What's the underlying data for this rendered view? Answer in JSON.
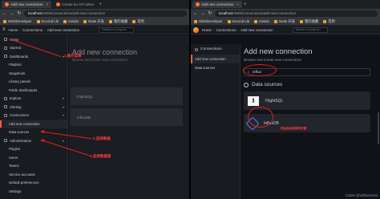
{
  "left": {
    "tabs": [
      {
        "label": "Add new connection",
        "active": true
      },
      {
        "label": "Create an API token",
        "active": false
      }
    ],
    "url_host": "localhost",
    "url_path": ":3000/connections/add-new-connection",
    "bookmarks": [
      "Web/Developer",
      "Second Lib",
      "mosdo",
      "Node 开发",
      "我的收藏",
      "常用"
    ],
    "breadcrumb": {
      "home": "Home",
      "section": "Connections",
      "page": "Add new connection"
    },
    "search_placeholder": "Search or jump to...",
    "menu": [
      {
        "label": "Home",
        "sub": false
      },
      {
        "label": "Starred",
        "sub": false
      },
      {
        "label": "Dashboards",
        "sub": false
      },
      {
        "label": "Playlists",
        "sub": true
      },
      {
        "label": "Snapshots",
        "sub": true
      },
      {
        "label": "Library panels",
        "sub": true
      },
      {
        "label": "Public dashboards",
        "sub": true
      },
      {
        "label": "Explore",
        "sub": false
      },
      {
        "label": "Alerting",
        "sub": false
      },
      {
        "label": "Connections",
        "sub": false
      },
      {
        "label": "Add new connection",
        "sub": true,
        "active": true
      },
      {
        "label": "Data sources",
        "sub": true
      },
      {
        "label": "Administration",
        "sub": false
      },
      {
        "label": "Plugins",
        "sub": true
      },
      {
        "label": "Users",
        "sub": true
      },
      {
        "label": "Teams",
        "sub": true
      },
      {
        "label": "Service accounts",
        "sub": true
      },
      {
        "label": "Default preferences",
        "sub": true
      },
      {
        "label": "Settings",
        "sub": true
      }
    ],
    "content_title": "Add new connection",
    "content_sub": "Browse and create new connections",
    "cards": [
      "FlightSQL",
      "InfluxDB"
    ],
    "annotations": [
      "1.展开菜单",
      "2.选择数据",
      "3.选择数据源"
    ]
  },
  "right": {
    "tabs": [
      {
        "label": "Add new connection",
        "active": true
      }
    ],
    "url_host": "localhost",
    "url_path": ":3000/connections/add-new-connection",
    "bookmarks": [
      "Web/Developer",
      "Second Lib",
      "mosdo",
      "Node 开发",
      "我的收藏",
      "常用"
    ],
    "breadcrumb": {
      "home": "Home",
      "section": "Connections",
      "page": "Add new connection"
    },
    "search_placeholder": "Search or jump to...",
    "sidebar_head": "Connections",
    "sidebar_items": [
      {
        "label": "Add new connection",
        "active": true
      },
      {
        "label": "Data sources",
        "active": false
      }
    ],
    "title": "Add new connection",
    "subtitle": "Browse and create new connections",
    "search_value": "influx",
    "section_title": "Data sources",
    "cards": [
      {
        "label": "FlightSQL",
        "logo": "flightsql-logo",
        "note": ""
      },
      {
        "label": "InfluxDB",
        "logo": "influxdb-logo",
        "note": "然后会出现新的页面"
      }
    ],
    "watermark": "CSDN @WilliamSanl"
  },
  "colors": {
    "accent": "#f55f3e",
    "annotation": "#e02020",
    "background": "#111217",
    "panel": "#181b1f"
  }
}
